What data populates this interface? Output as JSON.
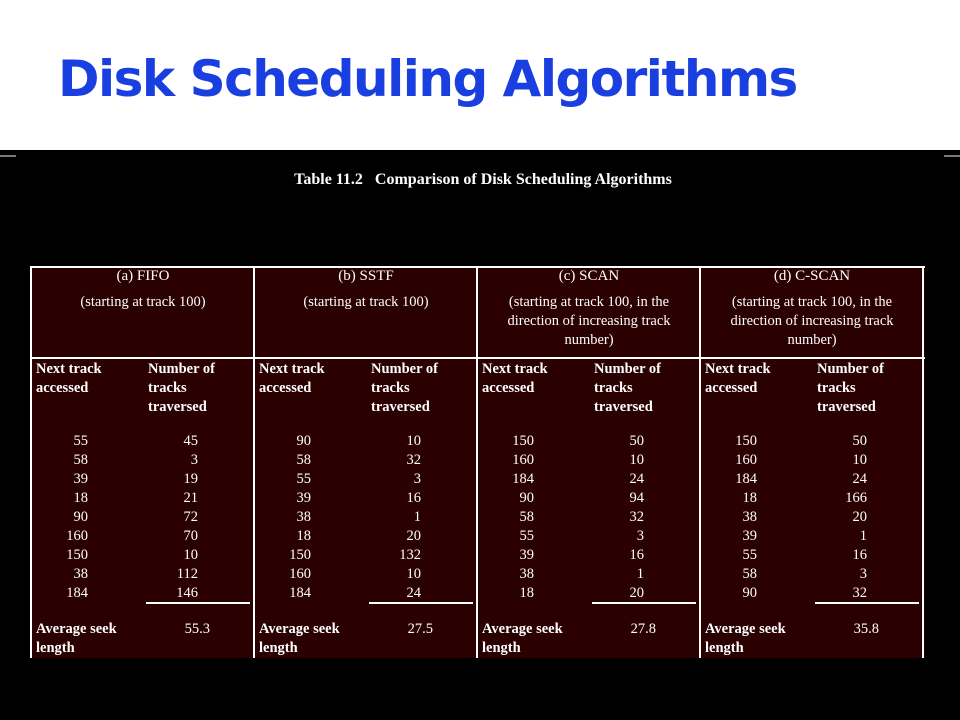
{
  "slide": {
    "title": "Disk Scheduling Algorithms"
  },
  "table": {
    "caption": "Table 11.2   Comparison of Disk Scheduling Algorithms",
    "columns": [
      {
        "title": "(a) FIFO",
        "subtitle": "(starting at track 100)",
        "header_next": "Next track accessed",
        "header_num": "Number of tracks traversed",
        "next": [
          "55",
          "58",
          "39",
          "18",
          "90",
          "160",
          "150",
          "38",
          "184"
        ],
        "traversed": [
          "45",
          "3",
          "19",
          "21",
          "72",
          "70",
          "10",
          "112",
          "146"
        ],
        "avg_label": "Average seek length",
        "avg_value": "55.3"
      },
      {
        "title": "(b) SSTF",
        "subtitle": "(starting at track 100)",
        "header_next": "Next track accessed",
        "header_num": "Number of tracks traversed",
        "next": [
          "90",
          "58",
          "55",
          "39",
          "38",
          "18",
          "150",
          "160",
          "184"
        ],
        "traversed": [
          "10",
          "32",
          "3",
          "16",
          "1",
          "20",
          "132",
          "10",
          "24"
        ],
        "avg_label": "Average seek length",
        "avg_value": "27.5"
      },
      {
        "title": "(c) SCAN",
        "subtitle": "(starting at track 100, in the direction of increasing track number)",
        "header_next": "Next track accessed",
        "header_num": "Number of tracks traversed",
        "next": [
          "150",
          "160",
          "184",
          "90",
          "58",
          "55",
          "39",
          "38",
          "18"
        ],
        "traversed": [
          "50",
          "10",
          "24",
          "94",
          "32",
          "3",
          "16",
          "1",
          "20"
        ],
        "avg_label": "Average seek length",
        "avg_value": "27.8"
      },
      {
        "title": "(d) C-SCAN",
        "subtitle": "(starting at track 100, in the direction of increasing track number)",
        "header_next": "Next track accessed",
        "header_num": "Number of tracks traversed",
        "next": [
          "150",
          "160",
          "184",
          "18",
          "38",
          "39",
          "55",
          "58",
          "90"
        ],
        "traversed": [
          "50",
          "10",
          "24",
          "166",
          "20",
          "1",
          "16",
          "3",
          "32"
        ],
        "avg_label": "Average seek length",
        "avg_value": "35.8"
      }
    ]
  },
  "colors": {
    "title": "#1a3fe0",
    "table_bg": "#2b0000",
    "slide_bg": "#000000"
  }
}
